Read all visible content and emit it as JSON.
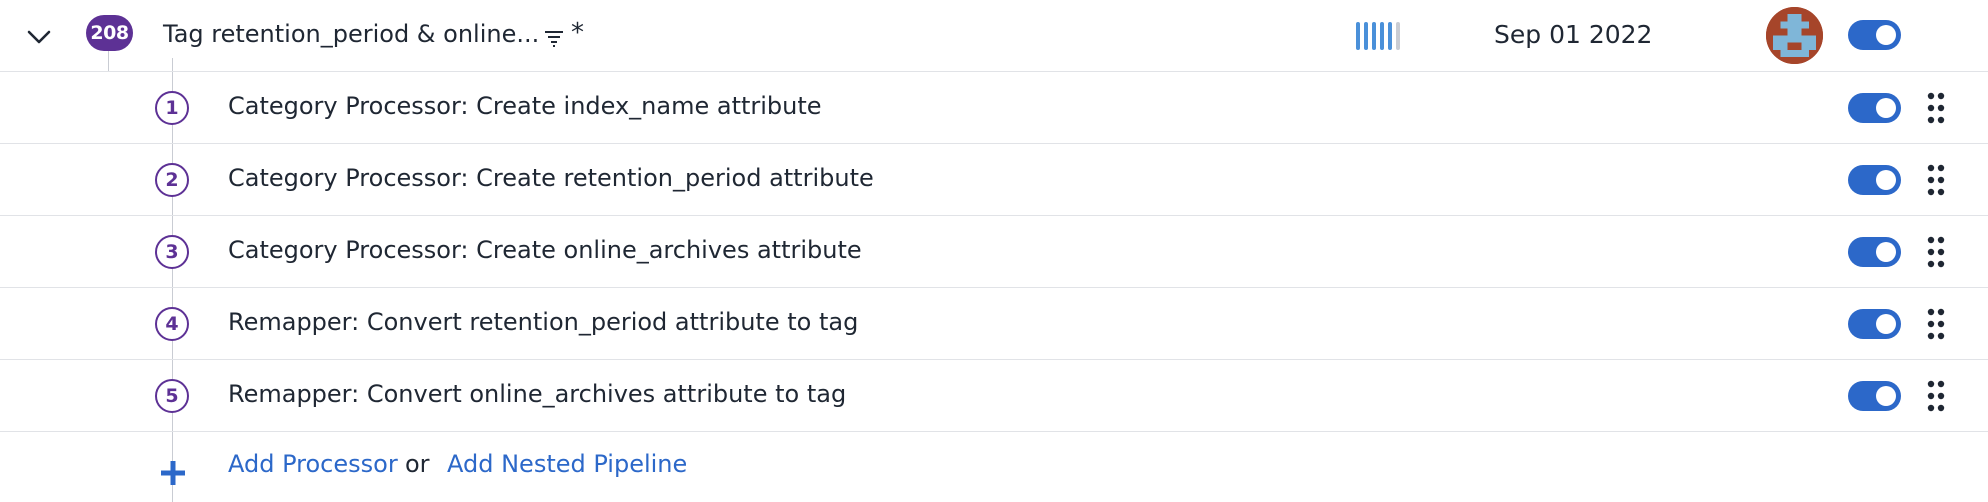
{
  "pipeline": {
    "count": "208",
    "name": "Tag retention_period & online...",
    "filter_query": "*",
    "date": "Sep 01 2022",
    "enabled": true
  },
  "processors": [
    {
      "step": "1",
      "label": "Category Processor: Create index_name attribute",
      "enabled": true
    },
    {
      "step": "2",
      "label": "Category Processor: Create retention_period attribute",
      "enabled": true
    },
    {
      "step": "3",
      "label": "Category Processor: Create online_archives attribute",
      "enabled": true
    },
    {
      "step": "4",
      "label": "Remapper: Convert retention_period attribute to tag",
      "enabled": true
    },
    {
      "step": "5",
      "label": "Remapper: Convert online_archives attribute to tag",
      "enabled": true
    }
  ],
  "footer": {
    "add_processor": "Add Processor",
    "or": "or",
    "add_nested_pipeline": "Add Nested Pipeline"
  },
  "icons": {
    "chevron": "chevron-down-icon",
    "filter": "filter-icon",
    "drag": "drag-handle-icon",
    "plus": "plus-icon"
  },
  "colors": {
    "accent": "#2c68c9",
    "badge": "#5d3195",
    "usage_bar_active": "#4a90d9",
    "usage_bar_inactive": "#c9ccd3"
  }
}
